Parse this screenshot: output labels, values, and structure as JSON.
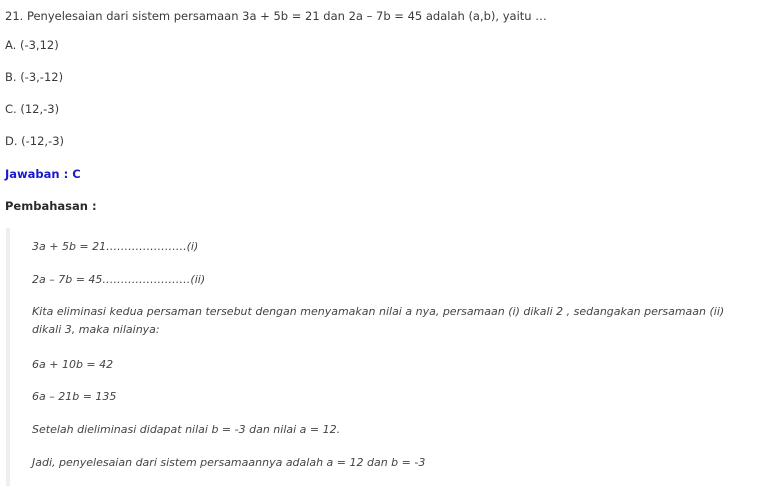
{
  "question": "21. Penyelesaian dari sistem persamaan 3a + 5b = 21 dan 2a – 7b = 45 adalah (a,b), yaitu …",
  "options": [
    "A. (-3,12)",
    "B. (-3,-12)",
    "C. (12,-3)",
    "D. (-12,-3)"
  ],
  "answer": "Jawaban : C",
  "discussion": {
    "title": "Pembahasan :",
    "lines": {
      "eq1": "3a + 5b = 21………………….(i)",
      "eq2": "2a – 7b = 45……………………(ii)",
      "explanation": "Kita eliminasi kedua persaman tersebut dengan menyamakan nilai a nya, persamaan (i) dikali 2 , sedangakan persamaan (ii) dikali 3, maka nilainya:",
      "eq3": "6a + 10b = 42",
      "eq4": "6a – 21b = 135",
      "result": "Setelah dieliminasi didapat nilai b = -3 dan nilai a = 12.",
      "conclusion": "Jadi, penyelesaian dari sistem persamaannya adalah a = 12 dan b = -3"
    }
  }
}
